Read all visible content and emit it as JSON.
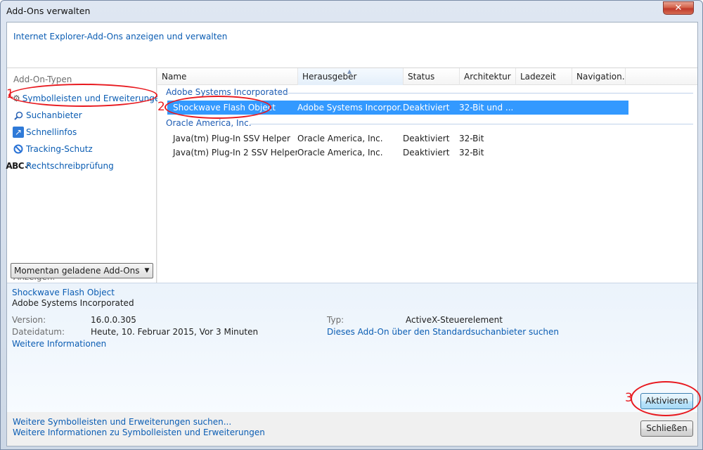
{
  "window": {
    "title": "Add-Ons verwalten",
    "close_glyph": "✕"
  },
  "header": {
    "text": "Internet Explorer-Add-Ons anzeigen und verwalten"
  },
  "sidebar": {
    "heading": "Add-On-Typen",
    "items": [
      {
        "label": "Symbolleisten und Erweiterungen",
        "icon": "gear-icon"
      },
      {
        "label": "Suchanbieter",
        "icon": "search-icon"
      },
      {
        "label": "Schnellinfos",
        "icon": "accelerator-icon"
      },
      {
        "label": "Tracking-Schutz",
        "icon": "tracking-protection-icon"
      },
      {
        "label": "Rechtschreibprüfung",
        "icon": "spelling-icon"
      }
    ],
    "show_label": "Anzeigen:",
    "show_value": "Momentan geladene Add-Ons"
  },
  "list": {
    "columns": [
      "Name",
      "Herausgeber",
      "Status",
      "Architektur",
      "Ladezeit",
      "Navigation..."
    ],
    "groups": [
      {
        "name": "Adobe Systems Incorporated",
        "rows": [
          {
            "name": "Shockwave Flash Object",
            "publisher": "Adobe Systems Incorpor...",
            "status": "Deaktiviert",
            "arch": "32-Bit und ..."
          }
        ]
      },
      {
        "name": "Oracle America, Inc.",
        "rows": [
          {
            "name": "Java(tm) Plug-In SSV Helper",
            "publisher": "Oracle America, Inc.",
            "status": "Deaktiviert",
            "arch": "32-Bit"
          },
          {
            "name": "Java(tm) Plug-In 2 SSV Helper",
            "publisher": "Oracle America, Inc.",
            "status": "Deaktiviert",
            "arch": "32-Bit"
          }
        ]
      }
    ]
  },
  "details": {
    "name": "Shockwave Flash Object",
    "publisher": "Adobe Systems Incorporated",
    "version_label": "Version:",
    "version_value": "16.0.0.305",
    "date_label": "Dateidatum:",
    "date_value": "Heute, 10. Februar 2015, Vor 3 Minuten",
    "more_info": "Weitere Informationen",
    "type_label": "Typ:",
    "type_value": "ActiveX-Steuerelement",
    "search_link": "Dieses Add-On über den Standardsuchanbieter suchen",
    "activate_button": "Aktivieren"
  },
  "footer": {
    "link1": "Weitere Symbolleisten und Erweiterungen suchen...",
    "link2": "Weitere Informationen zu Symbolleisten und Erweiterungen",
    "close_button": "Schließen"
  },
  "annotations": {
    "num1": "1",
    "num2": "2",
    "num3": "3",
    "color": "#e8191f"
  }
}
